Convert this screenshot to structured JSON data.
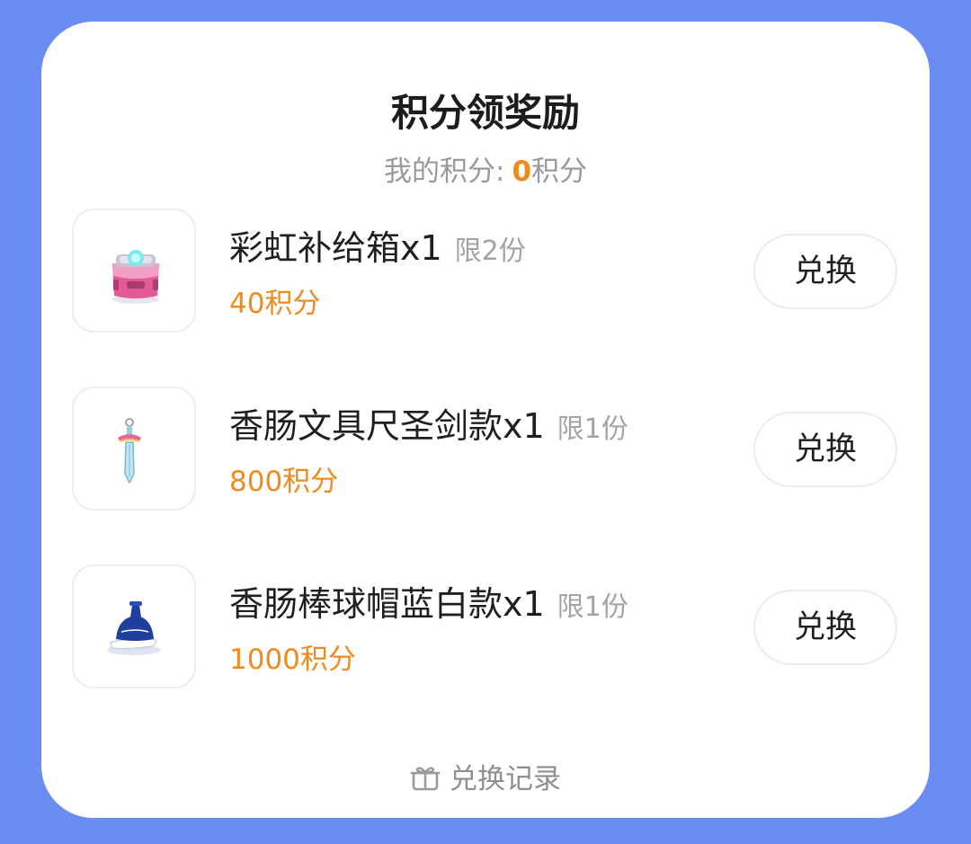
{
  "header": {
    "title": "积分领奖励",
    "points_label": "我的积分:",
    "points_value": "0",
    "points_unit": "积分"
  },
  "items": [
    {
      "name": "彩虹补给箱x1",
      "limit": "限2份",
      "cost": "40积分",
      "button": "兑换",
      "icon": "supply-box-icon"
    },
    {
      "name": "香肠文具尺圣剑款x1",
      "limit": "限1份",
      "cost": "800积分",
      "button": "兑换",
      "icon": "sword-ruler-icon"
    },
    {
      "name": "香肠棒球帽蓝白款x1",
      "limit": "限1份",
      "cost": "1000积分",
      "button": "兑换",
      "icon": "baseball-cap-icon"
    }
  ],
  "footer": {
    "history_label": "兑换记录",
    "history_icon": "gift-icon"
  },
  "colors": {
    "background": "#6b8cf0",
    "card": "#ffffff",
    "accent_orange": "#f08a1c",
    "muted_text": "#9a9a9a"
  }
}
